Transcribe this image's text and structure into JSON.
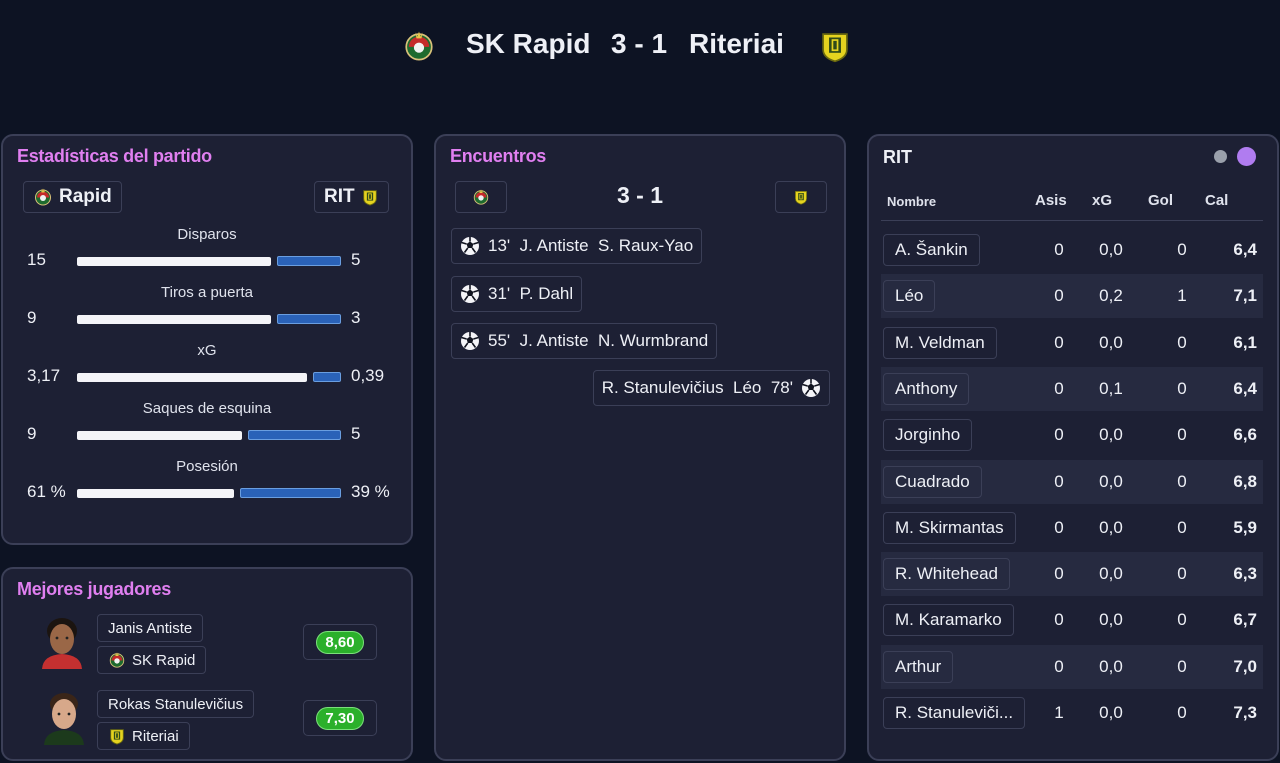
{
  "header": {
    "home_team": "SK Rapid",
    "score": "3 - 1",
    "away_team": "Riteriai"
  },
  "stats": {
    "title": "Estadísticas del partido",
    "home_label": "Rapid",
    "away_label": "RIT",
    "rows": [
      {
        "label": "Disparos",
        "home": "15",
        "away": "5",
        "home_share": 0.75
      },
      {
        "label": "Tiros a puerta",
        "home": "9",
        "away": "3",
        "home_share": 0.75
      },
      {
        "label": "xG",
        "home": "3,17",
        "away": "0,39",
        "home_share": 0.89
      },
      {
        "label": "Saques de esquina",
        "home": "9",
        "away": "5",
        "home_share": 0.64
      },
      {
        "label": "Posesión",
        "home": "61 %",
        "away": "39 %",
        "home_share": 0.61
      }
    ]
  },
  "top_players": {
    "title": "Mejores jugadores",
    "players": [
      {
        "name": "Janis Antiste",
        "team": "SK Rapid",
        "rating": "8,60"
      },
      {
        "name": "Rokas Stanulevičius",
        "team": "Riteriai",
        "rating": "7,30"
      }
    ]
  },
  "events": {
    "title": "Encuentros",
    "score": "3 - 1",
    "items": [
      {
        "side": "home",
        "text": "13'  J. Antiste  S. Raux-Yao"
      },
      {
        "side": "home",
        "text": "31'  P. Dahl"
      },
      {
        "side": "home",
        "text": "55'  J. Antiste  N. Wurmbrand"
      },
      {
        "side": "away",
        "text": "R. Stanulevičius  Léo  78'"
      }
    ]
  },
  "rit": {
    "title": "RIT",
    "colors": {
      "dot_gray": "#9aa0ab",
      "dot_purple": "#b07cf0"
    },
    "columns": {
      "name": "Nombre",
      "asis": "Asis",
      "xg": "xG",
      "gol": "Gol",
      "cal": "Cal"
    },
    "players": [
      {
        "name": "A. Šankin",
        "asis": "0",
        "xg": "0,0",
        "gol": "0",
        "cal": "6,4"
      },
      {
        "name": "Léo",
        "asis": "0",
        "xg": "0,2",
        "gol": "1",
        "cal": "7,1"
      },
      {
        "name": "M. Veldman",
        "asis": "0",
        "xg": "0,0",
        "gol": "0",
        "cal": "6,1"
      },
      {
        "name": "Anthony",
        "asis": "0",
        "xg": "0,1",
        "gol": "0",
        "cal": "6,4"
      },
      {
        "name": "Jorginho",
        "asis": "0",
        "xg": "0,0",
        "gol": "0",
        "cal": "6,6"
      },
      {
        "name": "Cuadrado",
        "asis": "0",
        "xg": "0,0",
        "gol": "0",
        "cal": "6,8"
      },
      {
        "name": "M. Skirmantas",
        "asis": "0",
        "xg": "0,0",
        "gol": "0",
        "cal": "5,9"
      },
      {
        "name": "R. Whitehead",
        "asis": "0",
        "xg": "0,0",
        "gol": "0",
        "cal": "6,3"
      },
      {
        "name": "M. Karamarko",
        "asis": "0",
        "xg": "0,0",
        "gol": "0",
        "cal": "6,7"
      },
      {
        "name": "Arthur",
        "asis": "0",
        "xg": "0,0",
        "gol": "0",
        "cal": "7,0"
      },
      {
        "name": "R. Stanuleviči...",
        "asis": "1",
        "xg": "0,0",
        "gol": "0",
        "cal": "7,3"
      }
    ]
  }
}
